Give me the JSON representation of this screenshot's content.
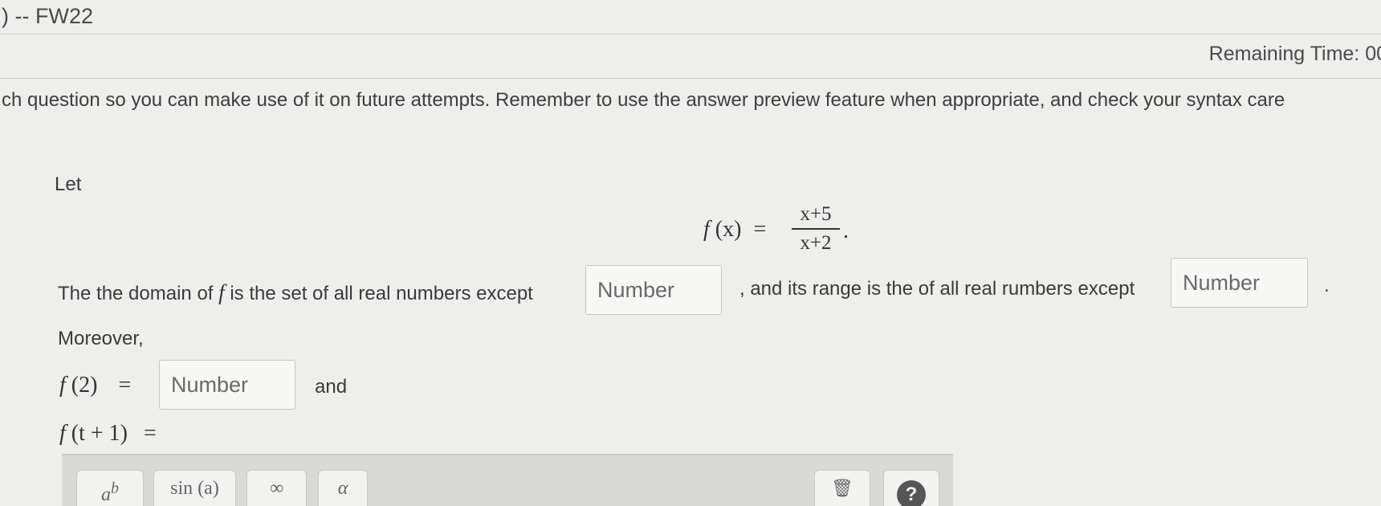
{
  "header": {
    "title": ") -- FW22",
    "remaining_time": "Remaining Time:  00"
  },
  "instructions": "ch question so you can make use of it on future attempts. Remember to use the answer preview feature when appropriate, and check your syntax care",
  "problem": {
    "let_label": "Let",
    "function_lhs_name": "f",
    "function_lhs_arg": "(x)",
    "equals": "=",
    "numerator": "x+5",
    "denominator": "x+2",
    "period": ".",
    "domain_text_before": "The the domain of",
    "domain_func": "f",
    "domain_text_after": "is the set of all real numbers except",
    "range_text": ", and its range is the of all real rumbers except",
    "range_end": ".",
    "moreover_label": "Moreover,",
    "f2_name": "f",
    "f2_arg": "(2)",
    "f2_equals": "=",
    "and_label": "and",
    "ft1_name": "f",
    "ft1_arg": "(t + 1)",
    "ft1_equals": "=",
    "answer_placeholder": "Number"
  },
  "toolbar": {
    "power_label": "a",
    "power_sup": "b",
    "sin_label": "sin (a)",
    "infinity_label": "∞",
    "alpha_label": "α",
    "trash_glyph": "🗑",
    "help_label": "?"
  }
}
